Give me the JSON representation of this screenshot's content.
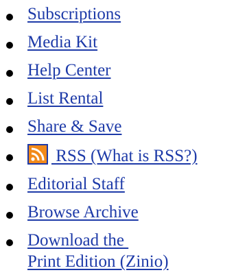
{
  "links": [
    {
      "label": "Subscriptions"
    },
    {
      "label": "Media Kit"
    },
    {
      "label": "Help Center"
    },
    {
      "label": "List Rental"
    },
    {
      "label": "Share & Save"
    },
    {
      "label": " RSS (What is RSS?)",
      "icon": "rss-icon"
    },
    {
      "label": "Editorial Staff"
    },
    {
      "label": "Browse Archive"
    },
    {
      "label_line1": "Download the ",
      "label_line2": "Print Edition (Zinio)"
    }
  ],
  "colors": {
    "link": "#1d3aa8",
    "bullet": "#000000",
    "rss_orange": "#f28a1a"
  }
}
